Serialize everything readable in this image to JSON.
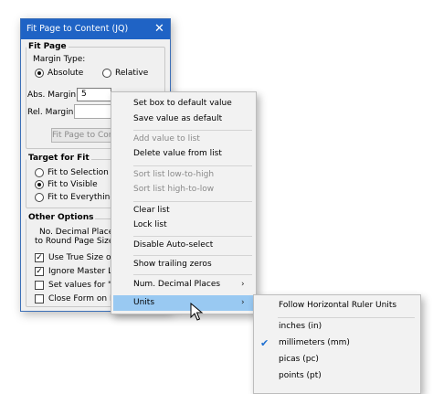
{
  "dialog": {
    "title": "Fit Page to Content (JQ)",
    "fit_page": {
      "group_label": "Fit Page",
      "margin_type_label": "Margin Type:",
      "absolute_label": "Absolute",
      "relative_label": "Relative",
      "abs_margin_label": "Abs. Margin",
      "abs_margin_value": "5",
      "rel_margin_label": "Rel. Margin",
      "fit_button_label": "Fit Page to Cont"
    },
    "target": {
      "group_label": "Target for Fit",
      "opt1": "Fit to Selection",
      "opt2": "Fit to Visible",
      "opt3": "Fit to Everything"
    },
    "other": {
      "group_label": "Other Options",
      "decimal_line1": "No. Decimal Places",
      "decimal_line2": "to Round Page Size",
      "chk1": "Use True Size of G",
      "chk2": "Ignore Master Lay",
      "chk3": "Set values for \"No",
      "chk4": "Close Form on FF"
    }
  },
  "context_menu": {
    "set_default_box": "Set box to default value",
    "save_default": "Save value as default",
    "add_to_list": "Add value to list",
    "delete_from_list": "Delete value from list",
    "sort_low_high": "Sort list low-to-high",
    "sort_high_low": "Sort list high-to-low",
    "clear_list": "Clear list",
    "lock_list": "Lock list",
    "disable_autoselect": "Disable Auto-select",
    "show_trailing_zeros": "Show trailing zeros",
    "num_decimal_places": "Num. Decimal Places",
    "units": "Units"
  },
  "units_submenu": {
    "follow_ruler": "Follow Horizontal Ruler Units",
    "inches": "inches (in)",
    "millimeters": "millimeters (mm)",
    "picas": "picas (pc)",
    "points": "points (pt)"
  }
}
